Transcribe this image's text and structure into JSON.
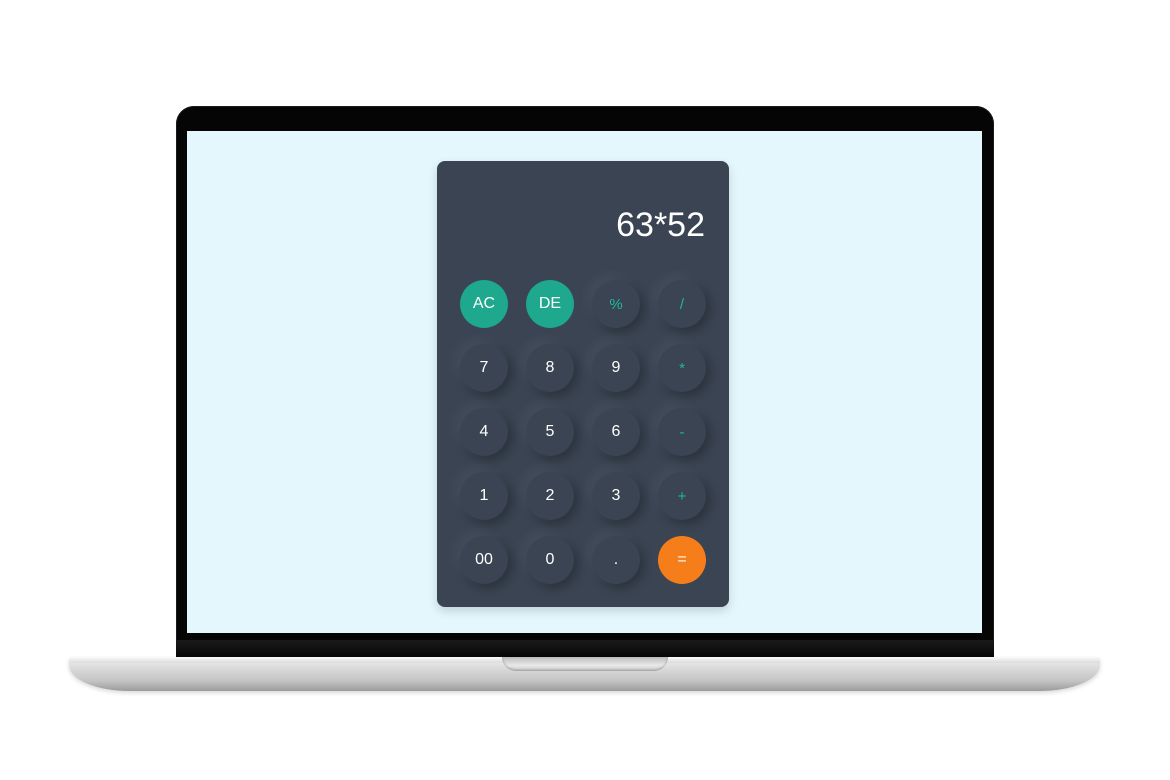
{
  "calculator": {
    "display": "63*52",
    "keys": [
      {
        "label": "AC",
        "kind": "func",
        "name": "ac-button"
      },
      {
        "label": "DE",
        "kind": "func",
        "name": "delete-button"
      },
      {
        "label": "%",
        "kind": "op",
        "name": "percent-button"
      },
      {
        "label": "/",
        "kind": "op",
        "name": "divide-button"
      },
      {
        "label": "7",
        "kind": "num",
        "name": "digit-7-button"
      },
      {
        "label": "8",
        "kind": "num",
        "name": "digit-8-button"
      },
      {
        "label": "9",
        "kind": "num",
        "name": "digit-9-button"
      },
      {
        "label": "*",
        "kind": "op",
        "name": "multiply-button"
      },
      {
        "label": "4",
        "kind": "num",
        "name": "digit-4-button"
      },
      {
        "label": "5",
        "kind": "num",
        "name": "digit-5-button"
      },
      {
        "label": "6",
        "kind": "num",
        "name": "digit-6-button"
      },
      {
        "label": "-",
        "kind": "op",
        "name": "subtract-button"
      },
      {
        "label": "1",
        "kind": "num",
        "name": "digit-1-button"
      },
      {
        "label": "2",
        "kind": "num",
        "name": "digit-2-button"
      },
      {
        "label": "3",
        "kind": "num",
        "name": "digit-3-button"
      },
      {
        "label": "+",
        "kind": "op",
        "name": "add-button"
      },
      {
        "label": "00",
        "kind": "num",
        "name": "double-zero-button"
      },
      {
        "label": "0",
        "kind": "num",
        "name": "digit-0-button"
      },
      {
        "label": ".",
        "kind": "num",
        "name": "decimal-point-button"
      },
      {
        "label": "=",
        "kind": "equals",
        "name": "equals-button"
      }
    ]
  },
  "colors": {
    "screen_background": "#e3f7fd",
    "calculator_body": "#3a4452",
    "function_key": "#1ea88d",
    "operator_text": "#1fb79a",
    "equals_key": "#f67e1a"
  }
}
